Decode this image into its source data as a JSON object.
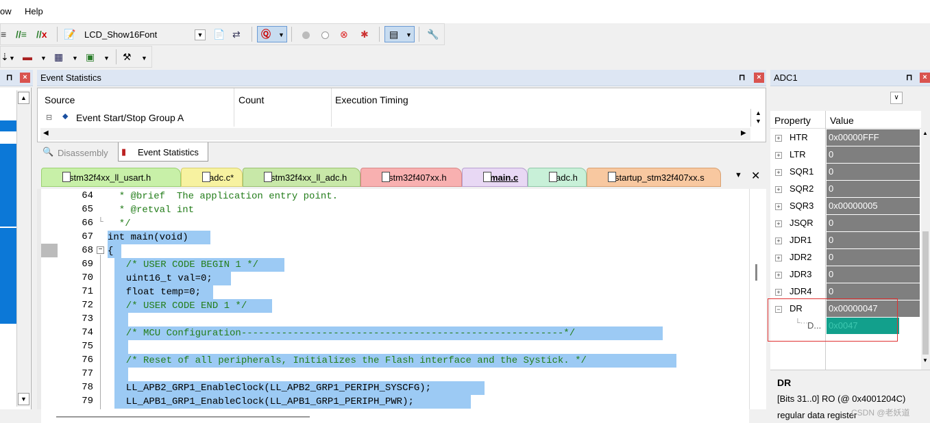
{
  "menu": {
    "window": "ow",
    "help": "Help"
  },
  "toolbar": {
    "target": "LCD_Show16Font"
  },
  "event_panel": {
    "title": "Event Statistics",
    "columns": [
      "Source",
      "Count",
      "Execution Timing"
    ],
    "row": "Event Start/Stop Group A",
    "bottom_tabs": [
      "Disassembly",
      "Event Statistics"
    ]
  },
  "editor_tabs": [
    "stm32f4xx_ll_usart.h",
    "adc.c*",
    "stm32f4xx_ll_adc.h",
    "stm32f407xx.h",
    "main.c",
    "adc.h",
    "startup_stm32f407xx.s"
  ],
  "code": {
    "line_numbers": [
      "64",
      "65",
      "66",
      "67",
      "68",
      "69",
      "70",
      "71",
      "72",
      "73",
      "74",
      "75",
      "76",
      "77",
      "78",
      "79"
    ],
    "lines": [
      "  * @brief  The application entry point.",
      "  * @retval int",
      "  */",
      "int main(void)",
      "{",
      "  /* USER CODE BEGIN 1 */",
      "  uint16_t val=0;",
      "  float temp=0;",
      "  /* USER CODE END 1 */",
      "",
      "  /* MCU Configuration--------------------------------------------------------*/",
      "",
      "  /* Reset of all peripherals, Initializes the Flash interface and the Systick. */",
      "",
      "  LL_APB2_GRP1_EnableClock(LL_APB2_GRP1_PERIPH_SYSCFG);",
      "  LL_APB1_GRP1_EnableClock(LL_APB1_GRP1_PERIPH_PWR);"
    ]
  },
  "adc_panel": {
    "title": "ADC1",
    "col_property": "Property",
    "col_value": "Value",
    "rows": [
      {
        "name": "HTR",
        "value": "0x00000FFF"
      },
      {
        "name": "LTR",
        "value": "0"
      },
      {
        "name": "SQR1",
        "value": "0"
      },
      {
        "name": "SQR2",
        "value": "0"
      },
      {
        "name": "SQR3",
        "value": "0x00000005"
      },
      {
        "name": "JSQR",
        "value": "0"
      },
      {
        "name": "JDR1",
        "value": "0"
      },
      {
        "name": "JDR2",
        "value": "0"
      },
      {
        "name": "JDR3",
        "value": "0"
      },
      {
        "name": "JDR4",
        "value": "0"
      },
      {
        "name": "DR",
        "value": "0x00000047"
      }
    ],
    "sub_row": {
      "name": "D...",
      "value": "0x0047"
    },
    "desc_title": "DR",
    "desc_line1": "[Bits 31..0] RO (@ 0x4001204C)",
    "desc_line2": "regular data register"
  },
  "watermark": "CSDN @老妖道"
}
